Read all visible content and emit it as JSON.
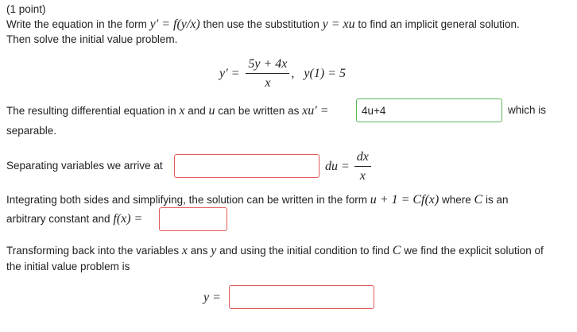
{
  "header": {
    "points": "(1 point)"
  },
  "intro": {
    "line1_a": "Write the equation in the form ",
    "form_expr": "y′ = f(y/x)",
    "line1_b": " then use the substitution ",
    "subst_expr": "y = xu",
    "line1_c": " to find an implicit general solution.",
    "line2": "Then solve the initial value problem."
  },
  "ivp": {
    "lhs": "y′ =",
    "numerator": "5y + 4x",
    "denominator": "x",
    "comma": ",",
    "condition": "y(1) = 5"
  },
  "step1": {
    "text_a": "The resulting differential equation in ",
    "var_x": "x",
    "text_b": " and ",
    "var_u": "u",
    "text_c": " can be written as ",
    "expr": "xu′ =",
    "answer_value": "4u+4",
    "text_d": "which is",
    "text_e": "separable."
  },
  "step2": {
    "text": "Separating variables we arrive at",
    "du_expr": "du =",
    "numerator": "dx",
    "denominator": "x",
    "answer_value": ""
  },
  "step3": {
    "text_a": "Integrating both sides and simplifying, the solution can be written in the form ",
    "form_expr": "u + 1 = Cf(x)",
    "text_b": " where ",
    "var_C": "C",
    "text_c": " is an",
    "text_d": "arbitrary constant and ",
    "fx_expr": "f(x) =",
    "answer_value": ""
  },
  "step4": {
    "text_a": "Transforming back into the variables ",
    "var_x": "x",
    "text_b": " ans ",
    "var_y": "y",
    "text_c": " and using the initial condition to find ",
    "var_C": "C",
    "text_d": " we find the explicit solution of",
    "text_e": "the initial value problem is",
    "y_expr": "y =",
    "answer_value": ""
  },
  "colors": {
    "error_border": "#e45a5a",
    "correct_border": "#5cb85c",
    "text": "#222222"
  }
}
